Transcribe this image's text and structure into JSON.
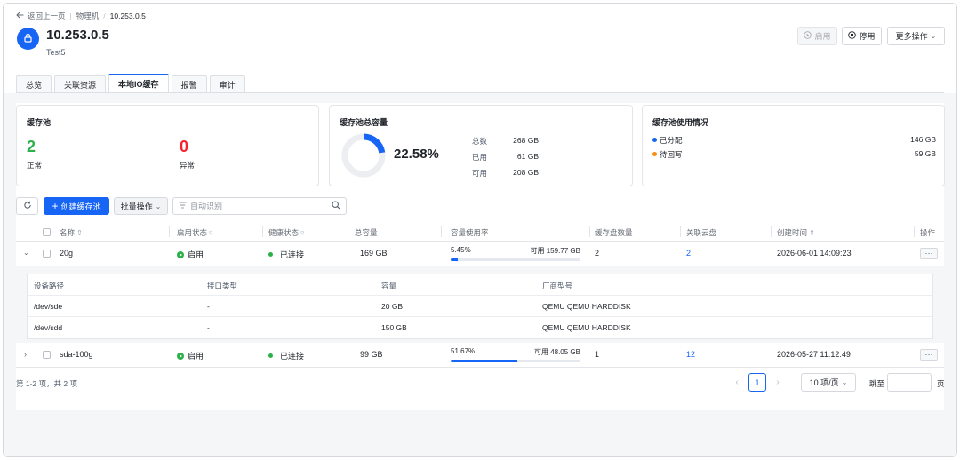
{
  "breadcrumb": {
    "back": "返回上一页",
    "parent": "物理机",
    "current": "10.253.0.5"
  },
  "host": {
    "name": "10.253.0.5",
    "sub": "Test5"
  },
  "actions": {
    "start": "启用",
    "stop": "停用",
    "more": "更多操作"
  },
  "tabs": [
    {
      "label": "总览"
    },
    {
      "label": "关联资源"
    },
    {
      "label": "本地IO缓存"
    },
    {
      "label": "报警"
    },
    {
      "label": "审计"
    }
  ],
  "pool_card": {
    "title": "缓存池",
    "normal_count": "2",
    "normal_label": "正常",
    "abnormal_count": "0",
    "abnormal_label": "异常"
  },
  "capacity_card": {
    "title": "缓存池总容量",
    "percent_text": "22.58%",
    "percent": 22.58,
    "total_label": "总数",
    "total_value": "268 GB",
    "used_label": "已用",
    "used_value": "61 GB",
    "avail_label": "可用",
    "avail_value": "208 GB"
  },
  "usage_card": {
    "title": "缓存池使用情况",
    "allocated_label": "已分配",
    "allocated_value": "146 GB",
    "writeback_label": "待回写",
    "writeback_value": "59 GB"
  },
  "toolbar": {
    "create": "创建缓存池",
    "batch": "批量操作",
    "search_placeholder": "自动识别"
  },
  "columns": {
    "name": "名称",
    "enable_state": "启用状态",
    "health": "健康状态",
    "total": "总容量",
    "usage": "容量使用率",
    "disk_count": "缓存盘数量",
    "cloud_disk": "关联云盘",
    "created": "创建时间",
    "ops": "操作"
  },
  "rows": [
    {
      "name": "20g",
      "enable_state": "启用",
      "health": "已连接",
      "total": "169 GB",
      "usage_text": "5.45%",
      "usage_avail": "可用 159.77 GB",
      "usage_value": 5.45,
      "disk_count": "2",
      "cloud_disk": "2",
      "created": "2026-06-01 14:09:23"
    },
    {
      "name": "sda-100g",
      "enable_state": "启用",
      "health": "已连接",
      "total": "99 GB",
      "usage_text": "51.67%",
      "usage_avail": "可用 48.05 GB",
      "usage_value": 51.67,
      "disk_count": "1",
      "cloud_disk": "12",
      "created": "2026-05-27 11:12:49"
    }
  ],
  "subtable": {
    "headers": {
      "path": "设备路径",
      "iface": "接口类型",
      "capacity": "容量",
      "model": "厂商型号"
    },
    "rows": [
      {
        "path": "/dev/sde",
        "iface": "-",
        "capacity": "20 GB",
        "model": "QEMU QEMU HARDDISK"
      },
      {
        "path": "/dev/sdd",
        "iface": "-",
        "capacity": "150 GB",
        "model": "QEMU QEMU HARDDISK"
      }
    ]
  },
  "pagination": {
    "summary": "第 1-2 项，共 2 项",
    "current_page": "1",
    "page_size": "10 项/页",
    "jump_label": "跳至",
    "page_suffix": "页"
  },
  "colors": {
    "primary": "#1765f4",
    "success": "#2cb14a",
    "danger": "#f5222d",
    "warning": "#fa8c16"
  },
  "icons": [
    "arrow-left-icon",
    "lock-icon",
    "play-circle-icon",
    "stop-circle-icon",
    "chevron-down-icon",
    "refresh-icon",
    "plus-icon",
    "filter-icon",
    "search-icon",
    "chevron-right-icon",
    "chevron-left-icon",
    "more-icon"
  ]
}
